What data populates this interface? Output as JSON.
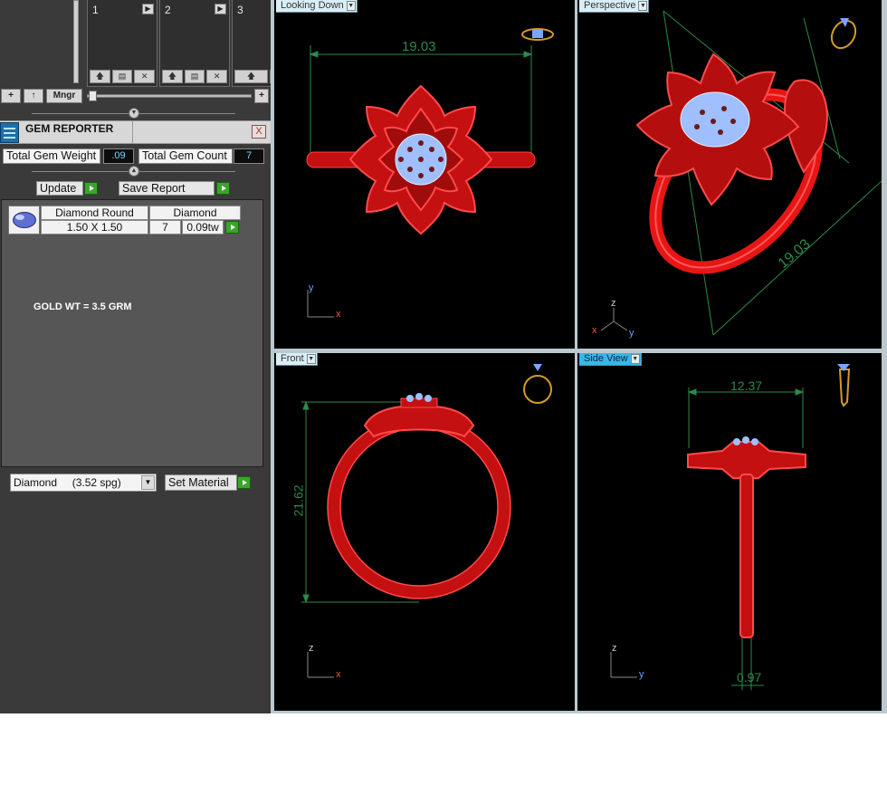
{
  "toolbar": {
    "slots": [
      {
        "label": "1"
      },
      {
        "label": "2"
      },
      {
        "label": "3"
      }
    ],
    "add_label": "+",
    "up_label": "↑",
    "mngr_label": "Mngr",
    "plus_label": "+"
  },
  "gem_reporter": {
    "title": "GEM REPORTER",
    "close_label": "X",
    "total_gem_weight_label": "Total Gem Weight",
    "total_gem_weight_value": ".09",
    "total_gem_count_label": "Total Gem Count",
    "total_gem_count_value": "7",
    "update_label": "Update",
    "save_report_label": "Save Report",
    "rows": [
      {
        "shape": "Diamond Round",
        "material": "Diamond",
        "size": "1.50 X 1.50",
        "count": "7",
        "weight": "0.09tw"
      }
    ],
    "note": "GOLD WT = 3.5 GRM",
    "material_select": "Diamond     (3.52 spg)",
    "set_material_label": "Set Material"
  },
  "viewports": {
    "top_left": {
      "label": "Looking Down",
      "dimension": "19.03",
      "axis_v": "y",
      "axis_h": "x"
    },
    "top_right": {
      "label": "Perspective",
      "dimension": "19.03",
      "axis_up": "z",
      "axis_l": "x",
      "axis_r": "y"
    },
    "bottom_left": {
      "label": "Front",
      "dimension": "21.62",
      "axis_v": "z",
      "axis_h": "x"
    },
    "bottom_right": {
      "label": "Side View",
      "dimension_top": "12.37",
      "dimension_bottom": "0.97",
      "axis_v": "z",
      "axis_h": "y"
    }
  },
  "colors": {
    "ring": "#e81515",
    "gem": "#a8c4ff",
    "dimension": "#2d8a4a",
    "active_tab": "#38b7ea"
  }
}
